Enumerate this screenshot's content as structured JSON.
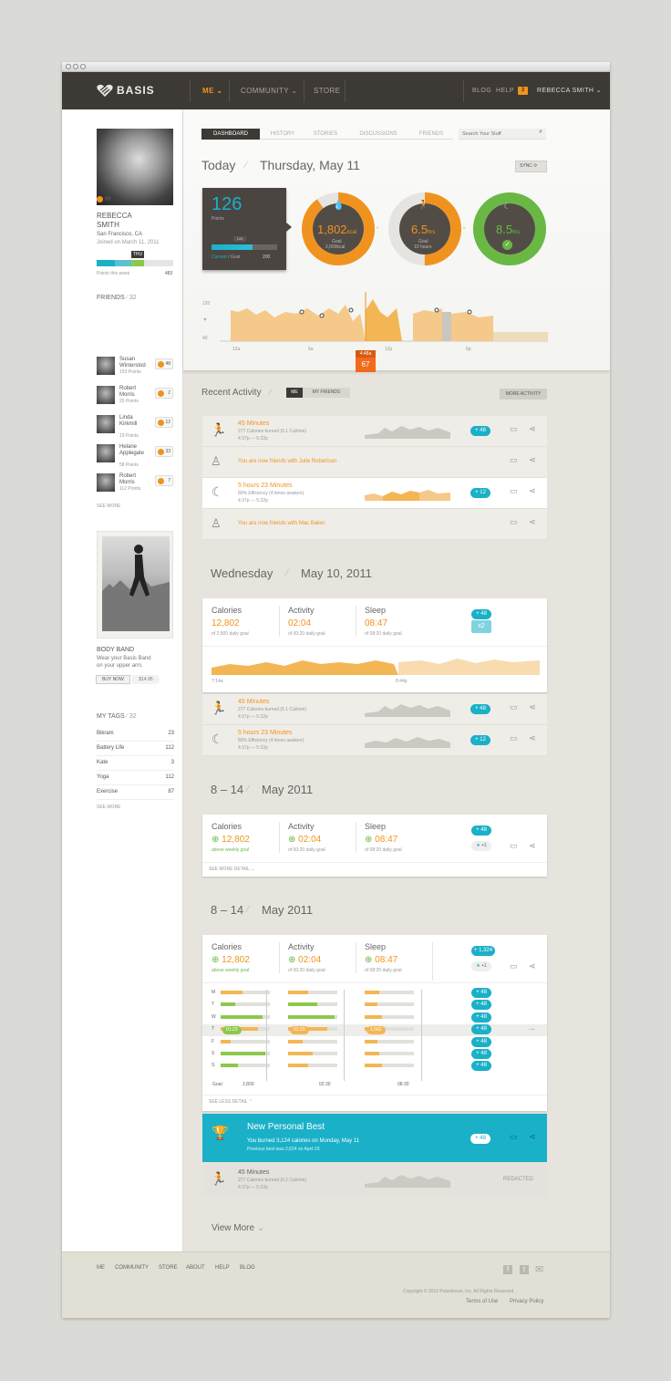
{
  "nav": {
    "logo": "BASIS",
    "me": "ME",
    "community": "COMMUNITY",
    "store": "STORE",
    "blog": "BLOG",
    "help": "HELP",
    "notifications": "3",
    "user": "REBECCA SMITH"
  },
  "profile": {
    "points_badge": "99",
    "name_first": "REBECCA",
    "name_last": "SMITH",
    "location": "San Francisco, CA",
    "joined": "Joined on March 11, 2011",
    "day_marker": "THU",
    "points_label": "Points this week",
    "points_value": "483"
  },
  "friends": {
    "title": "FRIENDS",
    "count": "32",
    "items": [
      {
        "name1": "Susan",
        "name2": "Winterstod",
        "points": "153 Points",
        "badge": "48"
      },
      {
        "name1": "Robert",
        "name2": "Morris",
        "points": "25 Points",
        "badge": "2"
      },
      {
        "name1": "Linda",
        "name2": "Kirkmill",
        "points": "19 Points",
        "badge": "12"
      },
      {
        "name1": "Helane",
        "name2": "Applegate",
        "points": "58 Points",
        "badge": "33"
      },
      {
        "name1": "Robert",
        "name2": "Morris",
        "points": "112 Points",
        "badge": "7"
      }
    ],
    "see_more": "SEE MORE"
  },
  "promo": {
    "title": "BODY BAND",
    "text1": "Wear your Basis Band",
    "text2": "on your upper arm.",
    "button": "BUY NOW",
    "price": "$14.95"
  },
  "tags": {
    "title": "MY TAGS",
    "count": "32",
    "items": [
      {
        "name": "Bikram",
        "count": "23"
      },
      {
        "name": "Battery Life",
        "count": "112"
      },
      {
        "name": "Kate",
        "count": "3"
      },
      {
        "name": "Yoga",
        "count": "112"
      },
      {
        "name": "Exercise",
        "count": "87"
      }
    ],
    "see_more": "SEE MORE"
  },
  "tabs": [
    "DASHBOARD",
    "HISTORY",
    "STORIES",
    "DISCUSSIONS",
    "FRIENDS"
  ],
  "search": {
    "placeholder": "Search Your Stuff"
  },
  "today": {
    "label": "Today",
    "date": "Thursday, May 11",
    "sync": "SYNC",
    "points": "126",
    "points_label": "Points",
    "bar_marker": "126",
    "bar_current": "Current",
    "bar_goal": "Goal",
    "bar_goal_value": "200",
    "calories": {
      "value": "1,802",
      "unit": "kcal",
      "goal_label": "Goal",
      "goal": "2,000kcal",
      "progress": 0.9
    },
    "activity": {
      "value": "6.5",
      "unit": "hrs",
      "goal_label": "Goal",
      "goal": "10 hours",
      "progress": 0.5
    },
    "sleep": {
      "value": "8.5",
      "unit": "hrs",
      "progress": 1.0
    },
    "timeline": {
      "y_top": "120",
      "y_bottom": "40",
      "ticks": [
        "12a",
        "6a",
        "12p",
        "6p"
      ],
      "marker_time": "4:48a",
      "marker_value": "67"
    }
  },
  "recent": {
    "title": "Recent Activity",
    "toggle_me": "ME",
    "toggle_friends": "MY FRIENDS",
    "more": "MORE ACTIVITY",
    "rows": [
      {
        "title": "45 Minutes",
        "line1": "277 Calories burned (6.1 Cal/min)",
        "line2": "4:37p — 5:22p",
        "badge": "+ 48"
      },
      {
        "text": "You are now friends with Julie Robertson"
      },
      {
        "title": "5 hours 23 Minutes",
        "line1": "80% Efficiency (4 times awaken)",
        "line2": "4:37p — 5:22p",
        "badge": "+ 12"
      },
      {
        "text": "You are now friends with Mac Baker"
      }
    ]
  },
  "wed": {
    "day": "Wednesday",
    "date": "May 10, 2011",
    "cal_label": "Calories",
    "cal_value": "12,802",
    "cal_sub": "of 2,500 daily goal",
    "act_label": "Activity",
    "act_value": "02:04",
    "act_sub": "of 00:20 daily goal",
    "sleep_label": "Sleep",
    "sleep_value": "08:47",
    "sleep_sub": "of 08:20 daily goal",
    "badge": "+ 48",
    "multiplier": "x2",
    "time_start": "7:14a",
    "time_end": "8:44p",
    "rows": [
      {
        "title": "45 Minutes",
        "line1": "277 Calories burned (6.1 Cal/min)",
        "line2": "4:37p — 5:22p",
        "badge": "+ 48"
      },
      {
        "title": "5 hours 23 Minutes",
        "line1": "80% Efficiency (4 times awaken)",
        "line2": "4:37p — 5:22p",
        "badge": "+ 12"
      }
    ]
  },
  "week1": {
    "range": "8 – 14",
    "month": "May 2011",
    "cal_label": "Calories",
    "cal_value": "12,802",
    "cal_sub": "above weekly goal",
    "act_label": "Activity",
    "act_value": "02:04",
    "act_sub": "of 00:20 daily goal",
    "sleep_label": "Sleep",
    "sleep_value": "08:47",
    "sleep_sub": "of 08:20 daily goal",
    "badge": "+ 48",
    "star": "+1",
    "see_more": "SEE MORE DETAIL"
  },
  "week2": {
    "range": "8 – 14",
    "month": "May 2011",
    "cal_label": "Calories",
    "cal_value": "12,802",
    "cal_sub": "above weekly goal",
    "act_label": "Activity",
    "act_value": "02:04",
    "act_sub": "of 00:20 daily goal",
    "sleep_label": "Sleep",
    "sleep_value": "08:47",
    "sleep_sub": "of 08:20 daily goal",
    "badge": "+ 1,324",
    "star": "+1",
    "days": [
      "M",
      "T",
      "W",
      "T",
      "F",
      "S",
      "S"
    ],
    "calories_fill": [
      0.45,
      0.3,
      0.85,
      0.75,
      0.2,
      0.9,
      0.35
    ],
    "activity_fill": [
      0.4,
      0.6,
      0.95,
      0.8,
      0.3,
      0.5,
      0.4
    ],
    "sleep_fill": [
      0.3,
      0.25,
      0.35,
      0.35,
      0.25,
      0.3,
      0.35
    ],
    "highlight_cal": "01:23",
    "highlight_act": "01:23",
    "highlight_sleep": "1,562",
    "row_badge": "+ 48",
    "goal_label": "Goal:",
    "goal_cal": "2,800",
    "goal_act": "02:30",
    "goal_sleep": "08:30",
    "see_less": "SEE LESS DETAIL"
  },
  "best": {
    "title": "New Personal Best",
    "line1": "You burned 3,124 calories on Monday, May 11",
    "line2": "Previous best was 2,634 on April 29",
    "badge": "+ 48"
  },
  "redacted_row": {
    "title": "45 Minutes",
    "line1": "277 Calories burned (6.1 Cal/min)",
    "line2": "4:37p — 5:22p",
    "status": "REDACTED"
  },
  "view_more": "View More",
  "footer": {
    "links": [
      "ME",
      "COMMUNITY",
      "STORE",
      "ABOUT",
      "HELP",
      "BLOG"
    ],
    "copyright": "Copyright © 2010 Pulsetracer, Inc. All Rights Reserved.",
    "terms": "Terms of Use",
    "privacy": "Privacy Policy"
  },
  "colors": {
    "orange": "#f0931e",
    "teal": "#1ab0c8",
    "green": "#6ab844",
    "dark": "#3d3935"
  }
}
